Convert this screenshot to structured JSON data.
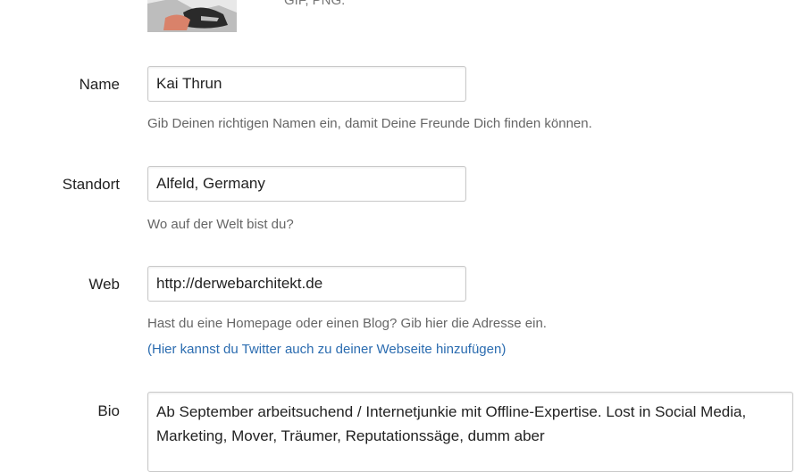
{
  "avatar": {
    "hint": "GIF, PNG."
  },
  "fields": {
    "name": {
      "label": "Name",
      "value": "Kai Thrun",
      "hint": "Gib Deinen richtigen Namen ein, damit Deine Freunde Dich finden können."
    },
    "location": {
      "label": "Standort",
      "value": "Alfeld, Germany",
      "hint": "Wo auf der Welt bist du?"
    },
    "web": {
      "label": "Web",
      "value": "http://derwebarchitekt.de",
      "hint": "Hast du eine Homepage oder einen Blog? Gib hier die Adresse ein.",
      "link": "(Hier kannst du Twitter auch zu deiner Webseite hinzufügen)"
    },
    "bio": {
      "label": "Bio",
      "value": "Ab September arbeitsuchend / Internetjunkie mit Offline-Expertise. Lost in Social Media, Marketing, Mover, Träumer, Reputationssäge, dumm aber"
    }
  },
  "colors": {
    "link": "#2b6cb0",
    "hint": "#666666",
    "border": "#c9c9c9"
  }
}
